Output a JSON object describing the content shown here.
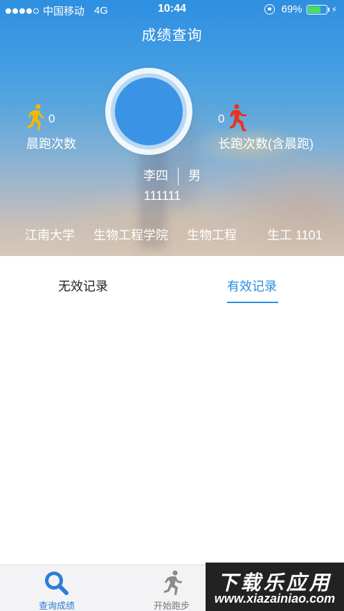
{
  "status_bar": {
    "carrier": "中国移动",
    "network": "4G",
    "time": "10:44",
    "battery": "69%",
    "battery_level": 0.69,
    "signal_bars_filled": 4,
    "signal_bars_total": 5
  },
  "header": {
    "title": "成绩查询"
  },
  "stats": {
    "morning_runs": {
      "count": "0",
      "label": "晨跑次数",
      "icon": "runner-icon",
      "color": "#f5b800"
    },
    "long_runs": {
      "count": "0",
      "label": "长跑次数(含晨跑)",
      "icon": "runner-icon",
      "color": "#e8331c"
    }
  },
  "profile": {
    "name": "李四",
    "gender": "男",
    "student_id": "111111"
  },
  "org": {
    "university": "江南大学",
    "college": "生物工程学院",
    "major": "生物工程",
    "class": "生工 1101"
  },
  "tabs": [
    {
      "label": "无效记录",
      "active": false
    },
    {
      "label": "有效记录",
      "active": true
    }
  ],
  "bottom_nav": [
    {
      "label": "查询成绩",
      "icon": "search-icon",
      "active": true
    },
    {
      "label": "开始跑步",
      "icon": "runner-icon",
      "active": false
    }
  ],
  "watermark": {
    "title": "下载乐应用",
    "url": "www.xiazainiao.com"
  },
  "colors": {
    "accent": "#2a8ce0",
    "avatar": "#3b93e6"
  }
}
